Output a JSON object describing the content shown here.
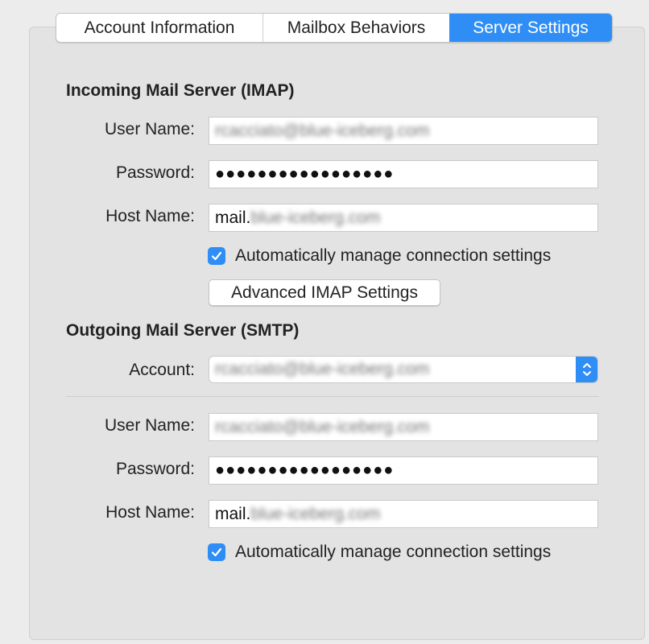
{
  "tabs": [
    {
      "label": "Account Information",
      "selected": false
    },
    {
      "label": "Mailbox Behaviors",
      "selected": false
    },
    {
      "label": "Server Settings",
      "selected": true
    }
  ],
  "incoming": {
    "title": "Incoming Mail Server (IMAP)",
    "user_name_label": "User Name:",
    "user_name_value": "rcacciato@blue-iceberg.com",
    "password_label": "Password:",
    "password_value": "●●●●●●●●●●●●●●●●●",
    "host_name_label": "Host Name:",
    "host_prefix": "mail.",
    "host_blurred": "blue-iceberg.com",
    "auto_manage_label": "Automatically manage connection settings",
    "auto_manage_checked": true,
    "advanced_button": "Advanced IMAP Settings"
  },
  "outgoing": {
    "title": "Outgoing Mail Server (SMTP)",
    "account_label": "Account:",
    "account_value": "rcacciato@blue-iceberg.com",
    "user_name_label": "User Name:",
    "user_name_value": "rcacciato@blue-iceberg.com",
    "password_label": "Password:",
    "password_value": "●●●●●●●●●●●●●●●●●",
    "host_name_label": "Host Name:",
    "host_prefix": "mail.",
    "host_blurred": "blue-iceberg.com",
    "auto_manage_label": "Automatically manage connection settings",
    "auto_manage_checked": true
  },
  "colors": {
    "accent": "#2f8ef5",
    "panel_bg": "#e3e3e3",
    "window_bg": "#ececec"
  }
}
